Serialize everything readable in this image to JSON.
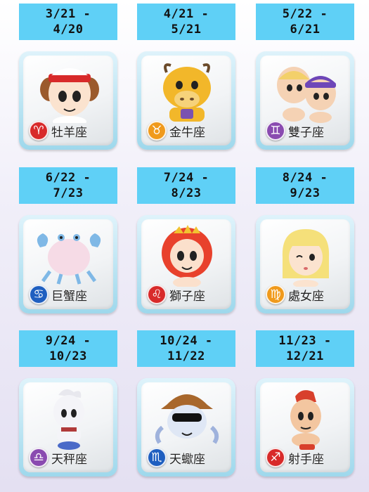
{
  "signs": [
    {
      "date_line1": "3/21 -",
      "date_line2": "4/20",
      "name": "牡羊座",
      "symbol": "♈",
      "badge_color": "#d82a2a",
      "icon": "aries-icon"
    },
    {
      "date_line1": "4/21 -",
      "date_line2": "5/21",
      "name": "金牛座",
      "symbol": "♉",
      "badge_color": "#f09a1c",
      "icon": "taurus-icon"
    },
    {
      "date_line1": "5/22 -",
      "date_line2": "6/21",
      "name": "雙子座",
      "symbol": "♊",
      "badge_color": "#8a4bb0",
      "icon": "gemini-icon"
    },
    {
      "date_line1": "6/22 -",
      "date_line2": "7/23",
      "name": "巨蟹座",
      "symbol": "♋",
      "badge_color": "#1f5fc0",
      "icon": "cancer-icon"
    },
    {
      "date_line1": "7/24 -",
      "date_line2": "8/23",
      "name": "獅子座",
      "symbol": "♌",
      "badge_color": "#d82a2a",
      "icon": "leo-icon"
    },
    {
      "date_line1": "8/24 -",
      "date_line2": "9/23",
      "name": "處女座",
      "symbol": "♍",
      "badge_color": "#f09a1c",
      "icon": "virgo-icon"
    },
    {
      "date_line1": "9/24 -",
      "date_line2": "10/23",
      "name": "天秤座",
      "symbol": "♎",
      "badge_color": "#8a4bb0",
      "icon": "libra-icon"
    },
    {
      "date_line1": "10/24 -",
      "date_line2": "11/22",
      "name": "天蠍座",
      "symbol": "♏",
      "badge_color": "#1f5fc0",
      "icon": "scorpio-icon"
    },
    {
      "date_line1": "11/23 -",
      "date_line2": "12/21",
      "name": "射手座",
      "symbol": "♐",
      "badge_color": "#d82a2a",
      "icon": "sagittarius-icon"
    }
  ]
}
